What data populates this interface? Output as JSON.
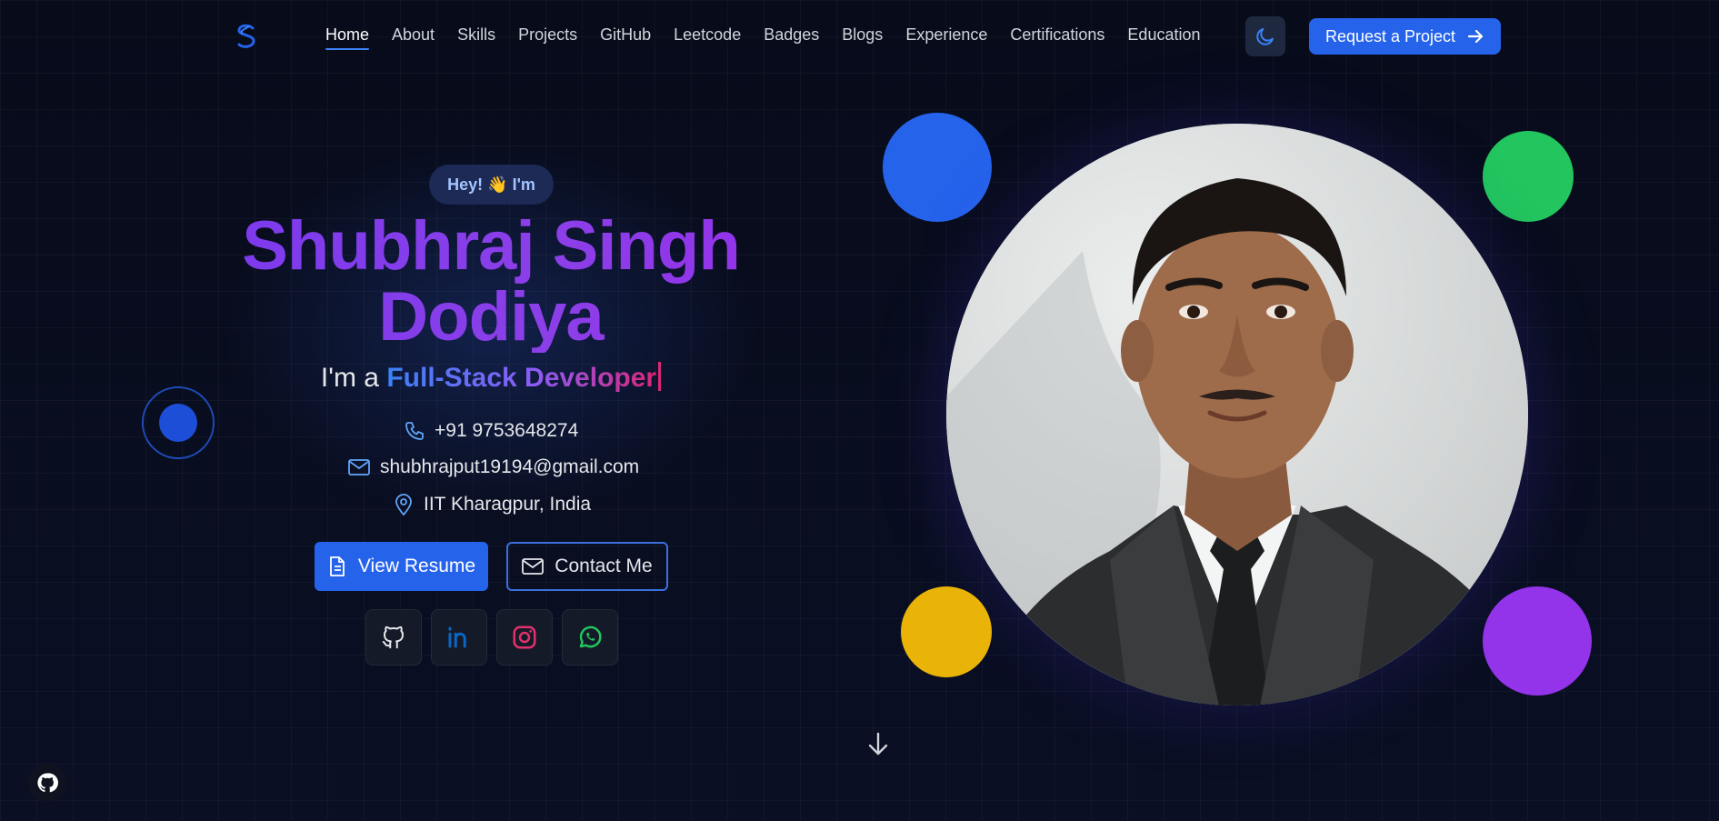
{
  "nav": {
    "links": [
      "Home",
      "About",
      "Skills",
      "Projects",
      "GitHub",
      "Leetcode",
      "Badges",
      "Blogs",
      "Experience",
      "Certifications",
      "Education"
    ],
    "active": "Home",
    "cta_label": "Request a Project",
    "theme_icon": "moon-icon",
    "logo_icon": "s-logo-icon"
  },
  "hero": {
    "greeting": "Hey! 👋 I'm",
    "name_line1": "Shubhraj Singh",
    "name_line2": "Dodiya",
    "role_prefix": "I'm a",
    "role_highlight": "Full-Stack Developer",
    "phone": "+91 9753648274",
    "email": "shubhrajput19194@gmail.com",
    "location": "IIT Kharagpur, India",
    "resume_label": "View Resume",
    "contact_label": "Contact Me",
    "socials": [
      "github-icon",
      "linkedin-icon",
      "instagram-icon",
      "whatsapp-icon"
    ]
  },
  "colors": {
    "accent": "#2563eb",
    "name_gradient": [
      "#7c3aed",
      "#9333ea"
    ],
    "role_gradient": [
      "#3b82f6",
      "#8b5cf6",
      "#db2777"
    ],
    "bubble_blue": "#2563eb",
    "bubble_green": "#22c55e",
    "bubble_yellow": "#eab308",
    "bubble_purple": "#9333ea"
  }
}
